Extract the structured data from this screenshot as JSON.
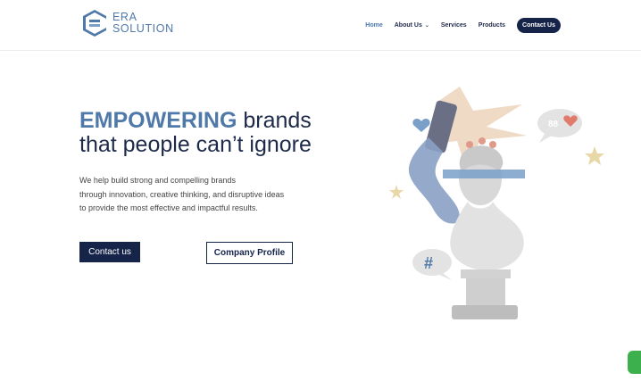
{
  "brand": {
    "name_line1": "ERA",
    "name_line2": "SOLUTION",
    "logo_color": "#4f79a9"
  },
  "nav": {
    "items": [
      {
        "label": "Home",
        "active": true
      },
      {
        "label": "About Us",
        "has_dropdown": true
      },
      {
        "label": "Services"
      },
      {
        "label": "Products"
      }
    ],
    "cta_label": "Contact Us"
  },
  "hero": {
    "title_strong": "EMPOWERING",
    "title_rest": " brands",
    "title_line2": "that people can’t ignore",
    "desc_line1": "We help build strong and compelling brands",
    "desc_line2": "through innovation, creative thinking, and disruptive ideas",
    "desc_line3": "to provide the most effective and impactful results.",
    "primary_button": "Contact us",
    "secondary_button": "Company Profile"
  },
  "illustration": {
    "chat_bubble_count": "88",
    "hashtag": "#"
  },
  "colors": {
    "navy": "#16244a",
    "accent_blue": "#4f79a9",
    "whatsapp_green": "#3bb04d"
  },
  "icons": [
    "era-logo-icon",
    "chevron-down-icon",
    "heart-icon",
    "star-icon",
    "hashtag-icon",
    "whatsapp-icon"
  ]
}
